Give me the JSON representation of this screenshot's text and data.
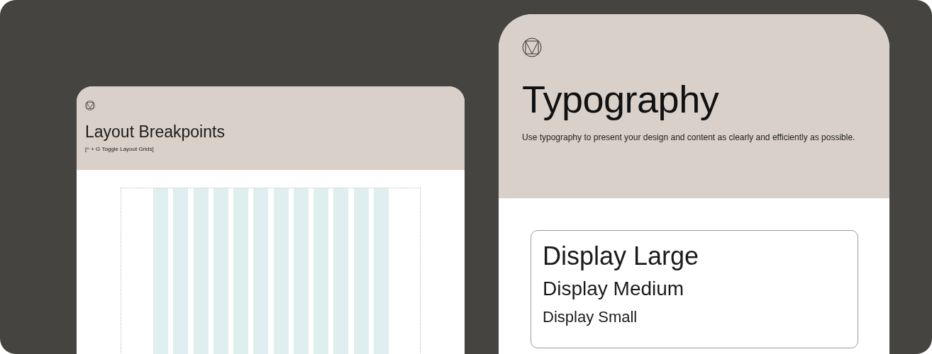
{
  "left_card": {
    "title": "Layout Breakpoints",
    "hint": "[^ + G Toggle Layout Grids]"
  },
  "right_card": {
    "title": "Typography",
    "description": "Use typography to present your design and content as clearly and efficiently as possible.",
    "type_scale": [
      {
        "label": "Display Large",
        "kind": "large"
      },
      {
        "label": "Display Medium",
        "kind": "medium"
      },
      {
        "label": "Display Small",
        "kind": "small"
      }
    ]
  }
}
